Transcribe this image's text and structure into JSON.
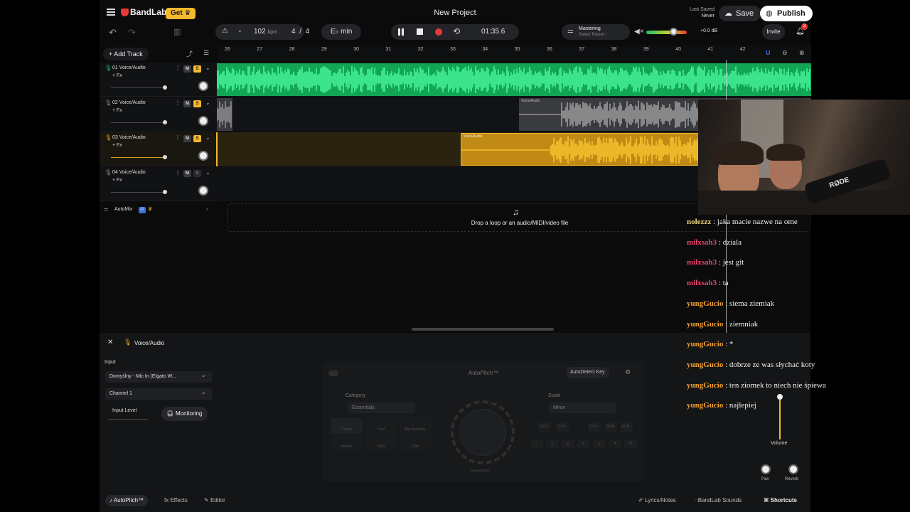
{
  "app": {
    "logo": "BandLab",
    "get_label": "Get",
    "project_title": "New Project",
    "last_saved_label": "Last Saved",
    "last_saved_value": "Never",
    "save_label": "Save",
    "publish_label": "Publish"
  },
  "toolbar": {
    "bpm": "102",
    "bpm_unit": "bpm",
    "time_sig_num": "4",
    "time_sig_sep": "/",
    "time_sig_den": "4",
    "key": "E♭ min",
    "time": "01:35.6",
    "mastering_label": "Mastering",
    "mastering_preset": "Select Preset",
    "gain": "+0.0 dB",
    "invite_label": "Invite",
    "notif_count": "2"
  },
  "tracks": {
    "add_track_label": "Add Track",
    "items": [
      {
        "name": "01 Voice/Audio",
        "fx": "+ Fx",
        "m": "M",
        "s": "S"
      },
      {
        "name": "02 Voice/Audio",
        "fx": "+ Fx",
        "m": "M",
        "s": "S"
      },
      {
        "name": "03 Voice/Audio",
        "fx": "+ Fx",
        "m": "M",
        "s": "S"
      },
      {
        "name": "04 Voice/Audio",
        "fx": "+ Fx",
        "m": "M",
        "s": "S"
      }
    ],
    "automix_label": "AutoMix",
    "automix_badge": "AI"
  },
  "ruler": [
    "26",
    "27",
    "28",
    "29",
    "30",
    "31",
    "32",
    "33",
    "34",
    "35",
    "36",
    "37",
    "38",
    "39",
    "40",
    "41",
    "42"
  ],
  "clips": {
    "clip2_label": "Voice/Audio",
    "clip3_label": "Voice/Audio"
  },
  "drop_zone": {
    "text": "Drop a loop or an audio/MIDI/video file"
  },
  "panel": {
    "title": "Voice/Audio",
    "input_label": "Input",
    "input_device": "Domyślny - Mic In (Elgato W...",
    "channel": "Channel 1",
    "input_level_label": "Input Level",
    "monitoring_label": "Monitoring",
    "autopitch_title": "AutoPitch™",
    "autodetect_label": "AutoDetect Key",
    "category_label": "Category",
    "category_value": "Essentials",
    "scale_label": "Scale",
    "scale_value": "Minor",
    "knob_label": "Heaviest",
    "effect_buttons": [
      "Classic",
      "Duet",
      "Big Harmony",
      "Robotic",
      "Wild",
      "Clap"
    ],
    "keys_top": [
      "C♯ D♭",
      "D♯ E♭",
      "F♯ G♭",
      "G♯ A♭",
      "A♯ B♭"
    ],
    "keys_bottom": [
      "C",
      "D",
      "E",
      "F",
      "G",
      "A",
      "B"
    ],
    "volume_label": "Volume",
    "pan_label": "Pan",
    "reverb_label": "Reverb",
    "tabs": {
      "autopitch": "AutoPitch™",
      "effects": "Effects",
      "editor": "Editor",
      "lyrics": "Lyrics/Notes",
      "sounds": "BandLab Sounds",
      "shortcuts": "Shortcuts"
    }
  },
  "chat": [
    {
      "user": "nolezzz",
      "msg": " : jaka macie nazwe na ome",
      "color": "#e8d27a"
    },
    {
      "user": "milxsah3",
      "msg": " : dziala",
      "color": "#e8476b"
    },
    {
      "user": "milxsah3",
      "msg": " : jest git",
      "color": "#e8476b"
    },
    {
      "user": "milxsah3",
      "msg": " : ta",
      "color": "#e8476b"
    },
    {
      "user": "yungGucio",
      "msg": " : siema ziemiak",
      "color": "#f0a030"
    },
    {
      "user": "yungGucio",
      "msg": " : ziemniak",
      "color": "#f0a030"
    },
    {
      "user": "yungGucio",
      "msg": " : *",
      "color": "#f0a030"
    },
    {
      "user": "yungGucio",
      "msg": " : dobrze ze was słychać koty",
      "color": "#f0a030"
    },
    {
      "user": "yungGucio",
      "msg": " : ten ziomek to niech nie śpiewa",
      "color": "#f0a030"
    },
    {
      "user": "yungGucio",
      "msg": " : najlepiej",
      "color": "#f0a030"
    }
  ],
  "webcam": {
    "mic_brand": "RØDE"
  },
  "colors": {
    "track1": "#1fbf6a",
    "track3": "#d9a21c",
    "accent": "#f5b82e",
    "record": "#e53935"
  }
}
